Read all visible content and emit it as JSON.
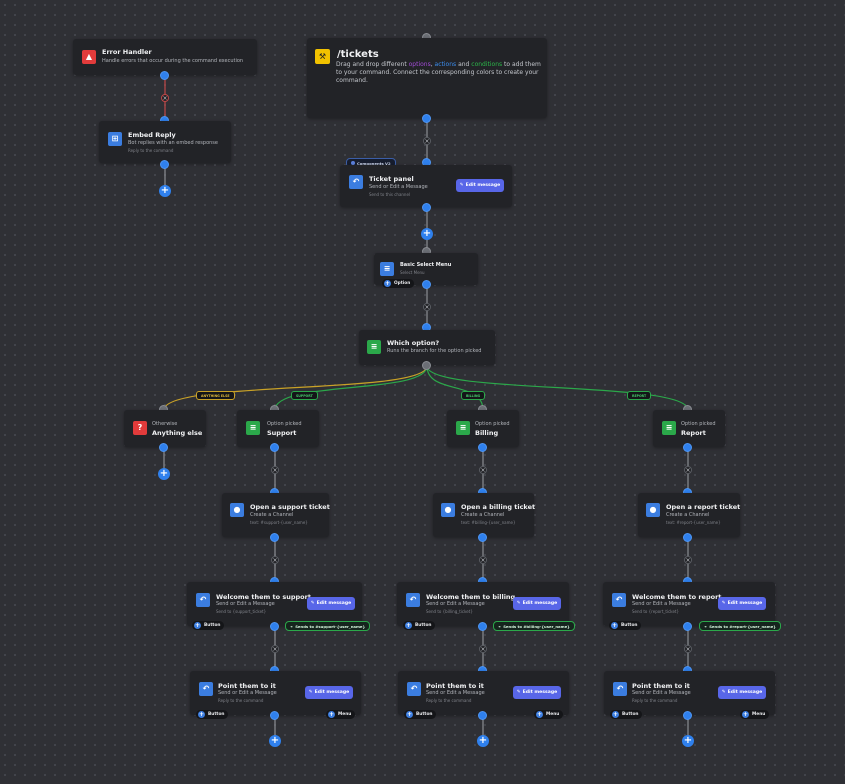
{
  "colors": {
    "canvas": "#2f3035",
    "node": "#222327",
    "blue_port": "#2f80ed",
    "action_icon": "#3b7de0",
    "condition_icon": "#2ba84a",
    "error_icon": "#e23b3b",
    "command_icon": "#f2c200",
    "edit_button": "#5866e8",
    "options_word": "#a24bd6",
    "actions_word": "#3b8ef0",
    "conditions_word": "#2bb84a",
    "anything_else_wire": "#c9a227",
    "branch_wire": "#2ba84a"
  },
  "command": {
    "title": "/tickets",
    "desc_1": "Drag and drop different ",
    "desc_options": "options",
    "desc_2": ", ",
    "desc_actions": "actions",
    "desc_3": " and ",
    "desc_conditions": "conditions",
    "desc_4": " to add them to your command. Connect the corresponding colors to create your command.",
    "icon": "command-icon"
  },
  "error_handler": {
    "title": "Error Handler",
    "subtitle": "Handle errors that occur during the command execution",
    "icon": "warning-icon"
  },
  "embed_reply": {
    "title": "Embed Reply",
    "subtitle": "Bot replies with an embed response",
    "detail": "Reply to the command",
    "icon": "embed-icon"
  },
  "ticket_panel": {
    "badge": "Components V2",
    "title": "Ticket panel",
    "subtitle": "Send or Edit a Message",
    "detail": "Send to this channel",
    "edit_label": "Edit message",
    "icon": "reply-icon"
  },
  "select_menu": {
    "title": "Basic Select Menu",
    "subtitle": "Select Menu",
    "option_label": "Option",
    "icon": "list-icon"
  },
  "which_option": {
    "title": "Which option?",
    "subtitle": "Runs the branch for the option picked",
    "icon": "list-icon"
  },
  "branch_labels": [
    "ANYTHING ELSE",
    "SUPPORT",
    "BILLING",
    "REPORT"
  ],
  "otherwise": {
    "subtitle": "Otherwise",
    "title": "Anything else",
    "icon": "question-icon"
  },
  "columns": [
    {
      "picked_subtitle": "Option picked",
      "picked_title": "Support",
      "ch_title": "Open a support ticket",
      "ch_subtitle": "Create a Channel",
      "ch_detail": "text: #support-{user_name}",
      "wel_title": "Welcome them to support",
      "wel_subtitle": "Send or Edit a Message",
      "wel_detail": "Send to {support_ticket}",
      "wel_edit": "Edit message",
      "wel_button": "Button",
      "wel_send": "Sends to #support-{user_name}",
      "pt_title": "Point them to it",
      "pt_subtitle": "Send or Edit a Message",
      "pt_detail": "Reply to the command",
      "pt_edit": "Edit message",
      "pt_button": "Button",
      "pt_menu": "Menu"
    },
    {
      "picked_subtitle": "Option picked",
      "picked_title": "Billing",
      "ch_title": "Open a billing ticket",
      "ch_subtitle": "Create a Channel",
      "ch_detail": "text: #billing-{user_name}",
      "wel_title": "Welcome them to billing",
      "wel_subtitle": "Send or Edit a Message",
      "wel_detail": "Send to {billing_ticket}",
      "wel_edit": "Edit message",
      "wel_button": "Button",
      "wel_send": "Sends to #billing-{user_name}",
      "pt_title": "Point them to it",
      "pt_subtitle": "Send or Edit a Message",
      "pt_detail": "Reply to the command",
      "pt_edit": "Edit message",
      "pt_button": "Button",
      "pt_menu": "Menu"
    },
    {
      "picked_subtitle": "Option picked",
      "picked_title": "Report",
      "ch_title": "Open a report ticket",
      "ch_subtitle": "Create a Channel",
      "ch_detail": "text: #report-{user_name}",
      "wel_title": "Welcome them to report",
      "wel_subtitle": "Send or Edit a Message",
      "wel_detail": "Send to {report_ticket}",
      "wel_edit": "Edit message",
      "wel_button": "Button",
      "wel_send": "Sends to #report-{user_name}",
      "pt_title": "Point them to it",
      "pt_subtitle": "Send or Edit a Message",
      "pt_detail": "Reply to the command",
      "pt_edit": "Edit message",
      "pt_button": "Button",
      "pt_menu": "Menu"
    }
  ]
}
